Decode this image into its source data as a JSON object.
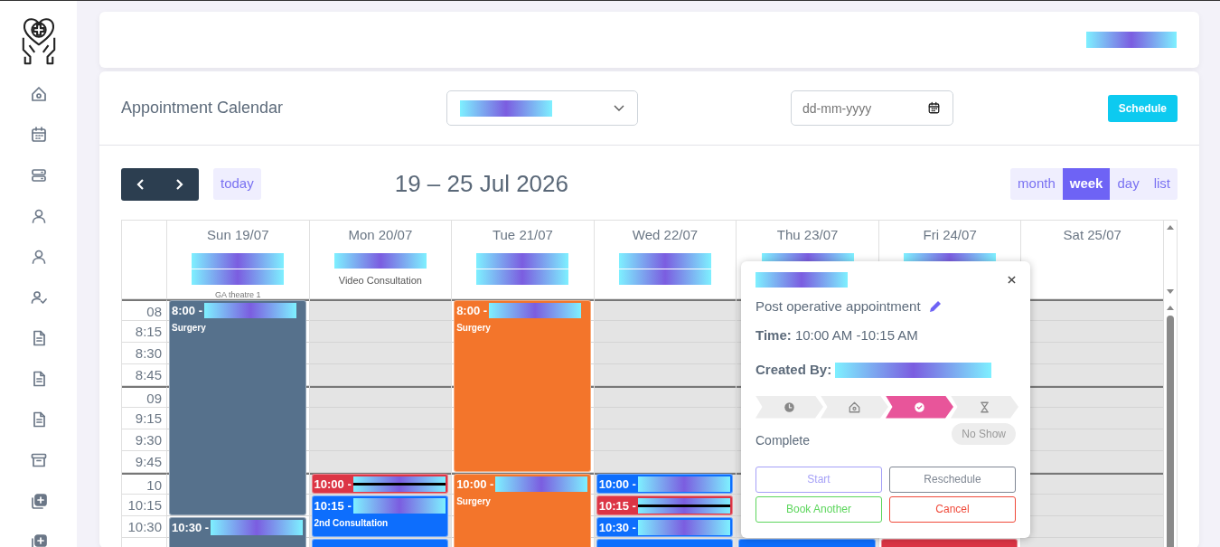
{
  "sidebar": {
    "items": [
      {
        "kind": "house"
      },
      {
        "kind": "calendar"
      },
      {
        "kind": "server"
      },
      {
        "kind": "user"
      },
      {
        "kind": "user"
      },
      {
        "kind": "user-check"
      },
      {
        "kind": "document"
      },
      {
        "kind": "document"
      },
      {
        "kind": "document"
      },
      {
        "kind": "archive"
      },
      {
        "kind": "copy-plus"
      },
      {
        "kind": "copy-plus"
      }
    ]
  },
  "top_bar": {
    "masked": true
  },
  "header": {
    "title": "Appointment Calendar",
    "filter_select": {
      "masked": true
    },
    "date_field": {
      "placeholder": "dd-mm-yyyy"
    },
    "schedule_button": "Schedule"
  },
  "toolbar": {
    "today": "today",
    "range": "19 – 25 Jul 2026",
    "views": [
      {
        "label": "month",
        "selected": false
      },
      {
        "label": "week",
        "selected": true
      },
      {
        "label": "day",
        "selected": false
      },
      {
        "label": "list",
        "selected": false
      }
    ]
  },
  "times": [
    {
      "label": "08",
      "hour": true
    },
    {
      "label": "8:15",
      "hour": false
    },
    {
      "label": "8:30",
      "hour": false
    },
    {
      "label": "8:45",
      "hour": false
    },
    {
      "label": "09",
      "hour": true
    },
    {
      "label": "9:15",
      "hour": false
    },
    {
      "label": "9:30",
      "hour": false
    },
    {
      "label": "9:45",
      "hour": false
    },
    {
      "label": "10",
      "hour": true
    },
    {
      "label": "10:15",
      "hour": false
    },
    {
      "label": "10:30",
      "hour": false
    }
  ],
  "days": [
    {
      "label": "Sun 19/07",
      "resources": [
        {
          "masked": true
        },
        {
          "masked": true
        }
      ],
      "note": "GA theatre 1",
      "events": [
        {
          "label": "8:00 -",
          "masked": true,
          "detail": "Surgery",
          "color": "#56718c",
          "cancelled": false
        },
        {
          "label": "10:30 -",
          "masked": true,
          "color": "#56718c",
          "cancelled": false
        }
      ]
    },
    {
      "label": "Mon 20/07",
      "resources": [
        {
          "masked": true
        }
      ],
      "note": "Video Consultation",
      "closed": true,
      "events": [
        {
          "label": "10:00 -",
          "masked": true,
          "color": "#dc3545",
          "cancelled": true
        },
        {
          "label": "10:15 -",
          "masked": true,
          "detail": "2nd Consultation",
          "color": "#0d6efd",
          "cancelled": false
        },
        {
          "kind": "partial",
          "color": "#0d6efd"
        }
      ]
    },
    {
      "label": "Tue 21/07",
      "resources": [
        {
          "masked": true
        },
        {
          "masked": true
        }
      ],
      "events": [
        {
          "label": "8:00 -",
          "masked": true,
          "detail": "Surgery",
          "color": "#f3752b",
          "cancelled": false
        },
        {
          "label": "10:00 -",
          "masked": true,
          "detail": "Surgery",
          "color": "#f3752b",
          "cancelled": false
        }
      ]
    },
    {
      "label": "Wed 22/07",
      "resources": [
        {
          "masked": true
        },
        {
          "masked": true
        }
      ],
      "closed": true,
      "events": [
        {
          "label": "10:00 -",
          "masked": true,
          "color": "#0d6efd",
          "cancelled": false
        },
        {
          "label": "10:15 -",
          "masked": true,
          "color": "#dc3545",
          "cancelled": true
        },
        {
          "label": "10:30 -",
          "masked": true,
          "color": "#0d6efd",
          "cancelled": false
        },
        {
          "kind": "partial",
          "color": "#0d6efd"
        }
      ]
    },
    {
      "label": "Thu 23/07",
      "resources": [
        {
          "masked": true
        }
      ],
      "closed": true,
      "events": [
        {
          "kind": "partial",
          "color": "#0d6efd"
        }
      ]
    },
    {
      "label": "Fri 24/07",
      "resources": [
        {
          "masked": true
        }
      ],
      "events": [
        {
          "kind": "partial",
          "color": "#dc3545"
        }
      ]
    },
    {
      "label": "Sat 25/07",
      "closed": true
    }
  ],
  "popover": {
    "title_masked": true,
    "type": "Post operative appointment",
    "time": "**Time:** 10:00 AM -10:15 AM",
    "created_by": "**Created By:**",
    "created_by_masked": true,
    "steps": [
      {
        "kind": "clock",
        "selected": false
      },
      {
        "kind": "house",
        "selected": false
      },
      {
        "kind": "check",
        "selected": true
      },
      {
        "kind": "hourglass",
        "selected": false
      }
    ],
    "status": "Complete",
    "no_show": "No Show",
    "buttons": [
      {
        "label": "Start",
        "kind": "start"
      },
      {
        "label": "Reschedule",
        "kind": "reschedule"
      },
      {
        "label": "Book Another",
        "kind": "book"
      },
      {
        "label": "Cancel",
        "kind": "cancel"
      }
    ]
  }
}
